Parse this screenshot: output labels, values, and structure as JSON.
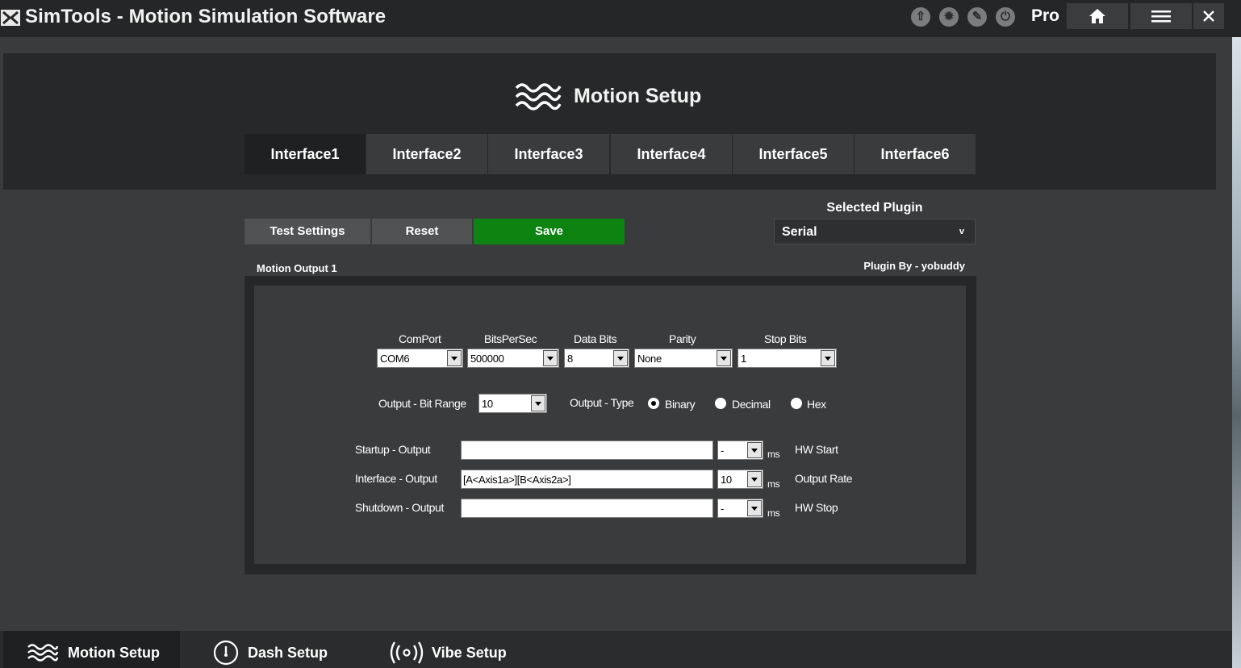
{
  "app": {
    "title": "SimTools - Motion Simulation Software",
    "edition": "Pro"
  },
  "titlebar": {
    "icons": [
      "up-arrow-icon",
      "settings-icon",
      "edit-icon",
      "power-icon",
      "home-icon",
      "menu-icon",
      "close-icon"
    ]
  },
  "header": {
    "title": "Motion Setup",
    "icon": "waves-icon"
  },
  "tabs": [
    {
      "label": "Interface1",
      "active": true
    },
    {
      "label": "Interface2",
      "active": false
    },
    {
      "label": "Interface3",
      "active": false
    },
    {
      "label": "Interface4",
      "active": false
    },
    {
      "label": "Interface5",
      "active": false
    },
    {
      "label": "Interface6",
      "active": false
    }
  ],
  "actions": {
    "test_label": "Test Settings",
    "reset_label": "Reset",
    "save_label": "Save",
    "save_color": "#0d8312"
  },
  "plugin": {
    "label": "Selected Plugin",
    "value": "Serial",
    "author": "Plugin By - yobuddy"
  },
  "output": {
    "section_label": "Motion Output 1",
    "serial": {
      "comport": {
        "label": "ComPort",
        "value": "COM6"
      },
      "bits_per_sec": {
        "label": "BitsPerSec",
        "value": "500000"
      },
      "data_bits": {
        "label": "Data Bits",
        "value": "8"
      },
      "parity": {
        "label": "Parity",
        "value": "None"
      },
      "stop_bits": {
        "label": "Stop Bits",
        "value": "1"
      }
    },
    "bit_range": {
      "label": "Output - Bit Range",
      "value": "10"
    },
    "type": {
      "label": "Output - Type",
      "options": [
        {
          "label": "Binary",
          "checked": true
        },
        {
          "label": "Decimal",
          "checked": false
        },
        {
          "label": "Hex",
          "checked": false
        }
      ]
    },
    "rows": [
      {
        "label": "Startup - Output",
        "value": "",
        "interval": "-",
        "unit": "ms",
        "suffix": "HW Start"
      },
      {
        "label": "Interface - Output",
        "value": "[A<Axis1a>][B<Axis2a>]",
        "interval": "10",
        "unit": "ms",
        "suffix": "Output Rate"
      },
      {
        "label": "Shutdown - Output",
        "value": "",
        "interval": "-",
        "unit": "ms",
        "suffix": "HW Stop"
      }
    ]
  },
  "bottom_nav": [
    {
      "label": "Motion Setup",
      "icon": "waves-icon",
      "active": true
    },
    {
      "label": "Dash Setup",
      "icon": "gauge-icon",
      "active": false
    },
    {
      "label": "Vibe Setup",
      "icon": "vibration-icon",
      "active": false
    }
  ]
}
